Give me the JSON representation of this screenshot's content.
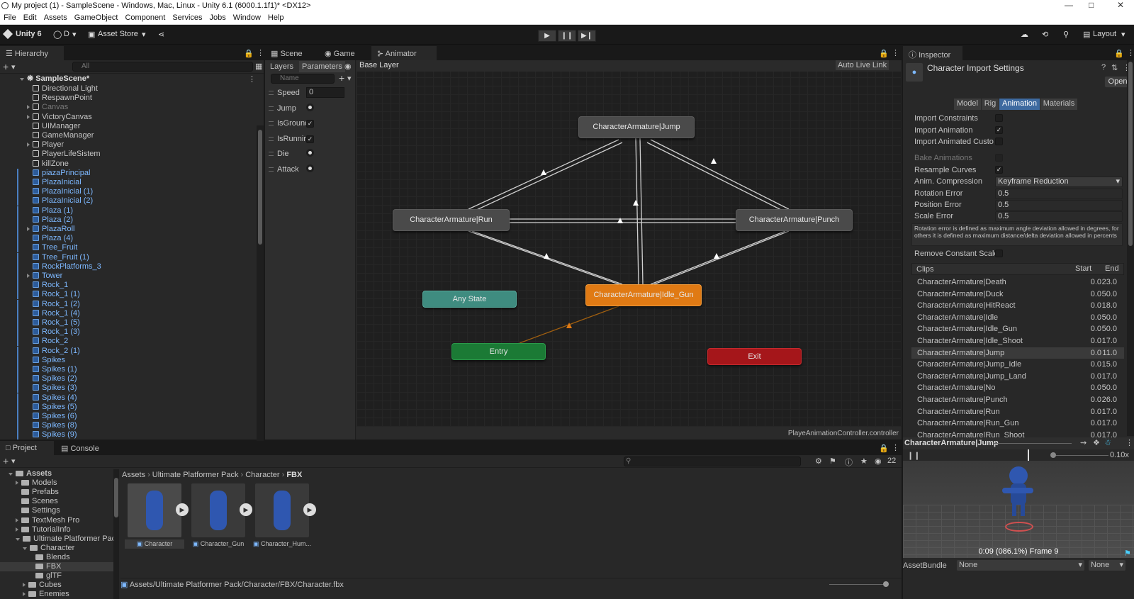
{
  "window": {
    "title": "My project (1) - SampleScene - Windows, Mac, Linux - Unity 6.1 (6000.1.1f1)* <DX12>"
  },
  "menu": [
    "File",
    "Edit",
    "Assets",
    "GameObject",
    "Component",
    "Services",
    "Jobs",
    "Window",
    "Help"
  ],
  "toolbar": {
    "unity": "Unity 6",
    "account": "D",
    "asset_store": "Asset Store",
    "layout": "Layout"
  },
  "hierarchy": {
    "tab": "Hierarchy",
    "search": "All",
    "scene": "SampleScene*",
    "items": [
      {
        "label": "Directional Light",
        "blue": false,
        "arrow": false
      },
      {
        "label": "RespawnPoint",
        "blue": false,
        "arrow": false
      },
      {
        "label": "Canvas",
        "blue": false,
        "arrow": true,
        "dim": true
      },
      {
        "label": "VictoryCanvas",
        "blue": false,
        "arrow": true
      },
      {
        "label": "UIManager",
        "blue": false,
        "arrow": false
      },
      {
        "label": "GameManager",
        "blue": false,
        "arrow": false
      },
      {
        "label": "Player",
        "blue": false,
        "arrow": true
      },
      {
        "label": "PlayerLifeSistem",
        "blue": false,
        "arrow": false
      },
      {
        "label": "killZone",
        "blue": false,
        "arrow": false
      },
      {
        "label": "piazaPrincipal",
        "blue": true,
        "arrow": false
      },
      {
        "label": "PlazaInicial",
        "blue": true,
        "arrow": false
      },
      {
        "label": "PlazaInicial (1)",
        "blue": true,
        "arrow": false
      },
      {
        "label": "PlazaInicial (2)",
        "blue": true,
        "arrow": false
      },
      {
        "label": "Plaza (1)",
        "blue": true,
        "arrow": false
      },
      {
        "label": "Plaza (2)",
        "blue": true,
        "arrow": false
      },
      {
        "label": "PlazaRoll",
        "blue": true,
        "arrow": true
      },
      {
        "label": "Plaza (4)",
        "blue": true,
        "arrow": false
      },
      {
        "label": "Tree_Fruit",
        "blue": true,
        "arrow": false
      },
      {
        "label": "Tree_Fruit (1)",
        "blue": true,
        "arrow": false
      },
      {
        "label": "RockPlatforms_3",
        "blue": true,
        "arrow": false
      },
      {
        "label": "Tower",
        "blue": true,
        "arrow": true
      },
      {
        "label": "Rock_1",
        "blue": true,
        "arrow": false
      },
      {
        "label": "Rock_1 (1)",
        "blue": true,
        "arrow": false
      },
      {
        "label": "Rock_1 (2)",
        "blue": true,
        "arrow": false
      },
      {
        "label": "Rock_1 (4)",
        "blue": true,
        "arrow": false
      },
      {
        "label": "Rock_1 (5)",
        "blue": true,
        "arrow": false
      },
      {
        "label": "Rock_1 (3)",
        "blue": true,
        "arrow": false
      },
      {
        "label": "Rock_2",
        "blue": true,
        "arrow": false
      },
      {
        "label": "Rock_2 (1)",
        "blue": true,
        "arrow": false
      },
      {
        "label": "Spikes",
        "blue": true,
        "arrow": false
      },
      {
        "label": "Spikes (1)",
        "blue": true,
        "arrow": false
      },
      {
        "label": "Spikes (2)",
        "blue": true,
        "arrow": false
      },
      {
        "label": "Spikes (3)",
        "blue": true,
        "arrow": false
      },
      {
        "label": "Spikes (4)",
        "blue": true,
        "arrow": false
      },
      {
        "label": "Spikes (5)",
        "blue": true,
        "arrow": false
      },
      {
        "label": "Spikes (6)",
        "blue": true,
        "arrow": false
      },
      {
        "label": "Spikes (8)",
        "blue": true,
        "arrow": false
      },
      {
        "label": "Spikes (9)",
        "blue": true,
        "arrow": false
      }
    ]
  },
  "center_tabs": {
    "scene": "Scene",
    "game": "Game",
    "animator": "Animator"
  },
  "animator": {
    "layers": "Layers",
    "parameters": "Parameters",
    "name_placeholder": "Name",
    "breadcrumb": "Base Layer",
    "auto_live_link": "Auto Live Link",
    "controller": "PlayeAnimationController.controller",
    "params": [
      {
        "name": "Speed",
        "type": "float",
        "value": "0"
      },
      {
        "name": "Jump",
        "type": "trigger"
      },
      {
        "name": "IsGrounde",
        "type": "bool",
        "value": "✓"
      },
      {
        "name": "IsRunning",
        "type": "bool",
        "value": "✓"
      },
      {
        "name": "Die",
        "type": "trigger"
      },
      {
        "name": "Attack",
        "type": "trigger"
      }
    ],
    "states": {
      "jump": "CharacterArmature|Jump",
      "run": "CharacterArmature|Run",
      "punch": "CharacterArmature|Punch",
      "idle": "CharacterArmature|Idle_Gun",
      "any": "Any State",
      "entry": "Entry",
      "exit": "Exit"
    }
  },
  "inspector": {
    "tab": "Inspector",
    "title": "Character Import Settings",
    "open": "Open",
    "tabs": [
      "Model",
      "Rig",
      "Animation",
      "Materials"
    ],
    "import_constraints": "Import Constraints",
    "import_animation": "Import Animation",
    "import_custom": "Import Animated Custom",
    "bake": "Bake Animations",
    "resample": "Resample Curves",
    "anim_compression_label": "Anim. Compression",
    "anim_compression": "Keyframe Reduction",
    "rotation_error_label": "Rotation Error",
    "rotation_error": "0.5",
    "position_error_label": "Position Error",
    "position_error": "0.5",
    "scale_error_label": "Scale Error",
    "scale_error": "0.5",
    "help": "Rotation error is defined as maximum angle deviation allowed in degrees, for others it is defined as maximum distance/delta deviation allowed in percents",
    "remove_constant": "Remove Constant Scale",
    "clips_header": "Clips",
    "start_header": "Start",
    "end_header": "End",
    "clips": [
      {
        "name": "CharacterArmature|Death",
        "start": "0.0",
        "end": "23.0"
      },
      {
        "name": "CharacterArmature|Duck",
        "start": "0.0",
        "end": "50.0"
      },
      {
        "name": "CharacterArmature|HitReact",
        "start": "0.0",
        "end": "18.0"
      },
      {
        "name": "CharacterArmature|Idle",
        "start": "0.0",
        "end": "50.0"
      },
      {
        "name": "CharacterArmature|Idle_Gun",
        "start": "0.0",
        "end": "50.0"
      },
      {
        "name": "CharacterArmature|Idle_Shoot",
        "start": "0.0",
        "end": "17.0"
      },
      {
        "name": "CharacterArmature|Jump",
        "start": "0.0",
        "end": "11.0"
      },
      {
        "name": "CharacterArmature|Jump_Idle",
        "start": "0.0",
        "end": "15.0"
      },
      {
        "name": "CharacterArmature|Jump_Land",
        "start": "0.0",
        "end": "17.0"
      },
      {
        "name": "CharacterArmature|No",
        "start": "0.0",
        "end": "50.0"
      },
      {
        "name": "CharacterArmature|Punch",
        "start": "0.0",
        "end": "26.0"
      },
      {
        "name": "CharacterArmature|Run",
        "start": "0.0",
        "end": "17.0"
      },
      {
        "name": "CharacterArmature|Run_Gun",
        "start": "0.0",
        "end": "17.0"
      },
      {
        "name": "CharacterArmature|Run_Shoot",
        "start": "0.0",
        "end": "17.0"
      }
    ],
    "preview_clip": "CharacterArmature|Jump",
    "speed": "0.10x",
    "preview_time": "0:09 (086.1%) Frame 9",
    "assetbundle_label": "AssetBundle",
    "assetbundle": "None",
    "assetbundle_variant": "None"
  },
  "project": {
    "tab": "Project",
    "console": "Console",
    "count": "22",
    "breadcrumb": [
      "Assets",
      "Ultimate Platformer Pack",
      "Character",
      "FBX"
    ],
    "tree": [
      {
        "label": "Assets",
        "indent": 0,
        "arrow": "down",
        "bold": true
      },
      {
        "label": "Models",
        "indent": 1,
        "arrow": "right"
      },
      {
        "label": "Prefabs",
        "indent": 1,
        "arrow": ""
      },
      {
        "label": "Scenes",
        "indent": 1,
        "arrow": ""
      },
      {
        "label": "Settings",
        "indent": 1,
        "arrow": ""
      },
      {
        "label": "TextMesh Pro",
        "indent": 1,
        "arrow": "right"
      },
      {
        "label": "TutorialInfo",
        "indent": 1,
        "arrow": "right"
      },
      {
        "label": "Ultimate Platformer Pack",
        "indent": 1,
        "arrow": "down"
      },
      {
        "label": "Character",
        "indent": 2,
        "arrow": "down"
      },
      {
        "label": "Blends",
        "indent": 3,
        "arrow": ""
      },
      {
        "label": "FBX",
        "indent": 3,
        "arrow": "",
        "selected": true
      },
      {
        "label": "glTF",
        "indent": 3,
        "arrow": ""
      },
      {
        "label": "Cubes",
        "indent": 2,
        "arrow": "right"
      },
      {
        "label": "Enemies",
        "indent": 2,
        "arrow": "right"
      }
    ],
    "assets": [
      "Character",
      "Character_Gun",
      "Character_Hum..."
    ],
    "path": "Assets/Ultimate Platformer Pack/Character/FBX/Character.fbx"
  }
}
